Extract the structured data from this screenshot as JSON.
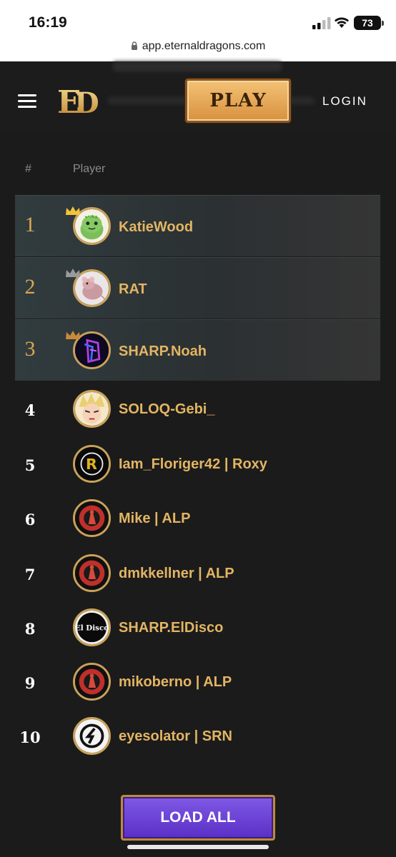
{
  "status": {
    "time": "16:19",
    "battery": "73"
  },
  "browser": {
    "url": "app.eternaldragons.com"
  },
  "header": {
    "logo_text": "ED",
    "play_label": "PLAY",
    "login_label": "LOGIN"
  },
  "table": {
    "columns": {
      "rank": "#",
      "player": "Player"
    },
    "rows": [
      {
        "rank": "1",
        "name": "KatieWood",
        "crown": "gold",
        "avatar": "dino-avatar"
      },
      {
        "rank": "2",
        "name": "RAT",
        "crown": "silver",
        "avatar": "rat-avatar"
      },
      {
        "rank": "3",
        "name": "SHARP.Noah",
        "crown": "bronze",
        "avatar": "neon-avatar"
      },
      {
        "rank": "4",
        "name": "SOLOQ-Gebi_",
        "avatar": "anime-avatar"
      },
      {
        "rank": "5",
        "name": "Iam_Floriger42 | Roxy",
        "avatar": "r-logo-avatar"
      },
      {
        "rank": "6",
        "name": "Mike | ALP",
        "avatar": "alpine-hunters-avatar"
      },
      {
        "rank": "7",
        "name": "dmkkellner | ALP",
        "avatar": "alpine-hunters-avatar"
      },
      {
        "rank": "8",
        "name": "SHARP.ElDisco",
        "avatar": "el-disco-avatar",
        "avatar_text": "El Disco"
      },
      {
        "rank": "9",
        "name": "mikoberno | ALP",
        "avatar": "alpine-hunters-avatar"
      },
      {
        "rank": "10",
        "name": "eyesolator | SRN",
        "avatar": "srn-logo-avatar"
      }
    ]
  },
  "load_all_label": "LOAD ALL",
  "colors": {
    "gold": "#e2b563",
    "accent_purple": "#6a3fd6",
    "background": "#1b1b1b"
  }
}
